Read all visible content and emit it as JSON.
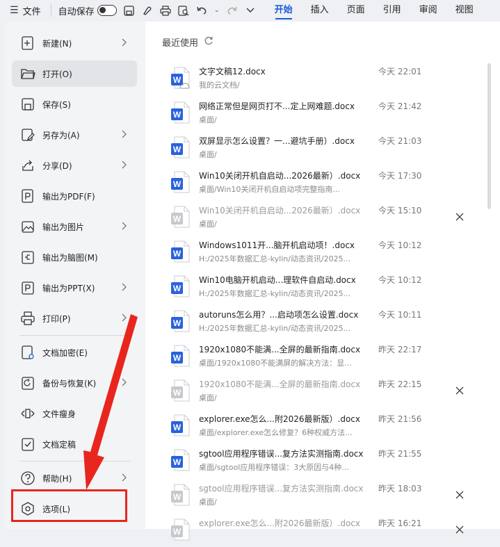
{
  "topbar": {
    "file_label": "文件",
    "autosave_label": "自动保存",
    "tabs": [
      "开始",
      "插入",
      "页面",
      "引用",
      "审阅",
      "视图"
    ]
  },
  "menu": {
    "items": [
      {
        "label": "新建(N)",
        "icon": "new-doc-icon",
        "chevron": true
      },
      {
        "label": "打开(O)",
        "icon": "folder-icon",
        "chevron": false
      },
      {
        "label": "保存(S)",
        "icon": "save-icon",
        "chevron": false
      },
      {
        "label": "另存为(A)",
        "icon": "save-as-icon",
        "chevron": true
      },
      {
        "label": "分享(D)",
        "icon": "share-icon",
        "chevron": true
      },
      {
        "label": "输出为PDF(F)",
        "icon": "pdf-icon",
        "chevron": false
      },
      {
        "label": "输出为图片",
        "icon": "image-icon",
        "chevron": true
      },
      {
        "label": "输出为脑图(M)",
        "icon": "mindmap-icon",
        "chevron": false
      },
      {
        "label": "输出为PPT(X)",
        "icon": "ppt-icon",
        "chevron": true
      },
      {
        "label": "打印(P)",
        "icon": "print-icon",
        "chevron": true
      },
      {
        "label": "文档加密(E)",
        "icon": "lock-doc-icon",
        "chevron": true
      },
      {
        "label": "备份与恢复(K)",
        "icon": "backup-icon",
        "chevron": true
      },
      {
        "label": "文件瘦身",
        "icon": "slim-icon",
        "chevron": false
      },
      {
        "label": "文档定稿",
        "icon": "finalize-icon",
        "chevron": false
      },
      {
        "label": "帮助(H)",
        "icon": "help-icon",
        "chevron": true
      },
      {
        "label": "选项(L)",
        "icon": "options-icon",
        "chevron": false
      }
    ]
  },
  "recent": {
    "title": "最近使用",
    "files": [
      {
        "name": "文字文稿12.docx",
        "path": "我的云文档/",
        "time": "今天 22:01",
        "dim": false,
        "close": false,
        "cloud": true
      },
      {
        "name": "网络正常但是网页打不...定上网难题.docx",
        "path": "桌面/",
        "time": "今天 21:42",
        "dim": false,
        "close": false
      },
      {
        "name": "双屏显示怎么设置？一...避坑手册）.docx",
        "path": "桌面/",
        "time": "今天 21:03",
        "dim": false,
        "close": false
      },
      {
        "name": "Win10关闭开机自启动...2026最新）.docx",
        "path": "桌面/Win10关闭开机自启动项完整指南...",
        "time": "今天 17:30",
        "dim": false,
        "close": false
      },
      {
        "name": "Win10关闭开机自启动...2026最新）.docx",
        "path": "桌面/",
        "time": "今天 15:10",
        "dim": true,
        "close": true
      },
      {
        "name": "Windows1011开...脑开机启动项！.docx",
        "path": "H:/2025年数据汇总-kylin/动态资讯/2025...",
        "time": "今天 10:12",
        "dim": false,
        "close": false
      },
      {
        "name": "Win10电脑开机启动...理软件自启动.docx",
        "path": "H:/2025年数据汇总-kylin/动态资讯/2025...",
        "time": "今天 10:12",
        "dim": false,
        "close": false
      },
      {
        "name": "autoruns怎么用？...启动项怎么设置.docx",
        "path": "H:/2025年数据汇总-kylin/动态资讯/2025...",
        "time": "今天 10:11",
        "dim": false,
        "close": false
      },
      {
        "name": "1920x1080不能满...全屏的最新指南.docx",
        "path": "桌面/1920x1080不能满屏的解决方法：显...",
        "time": "昨天 22:17",
        "dim": false,
        "close": false
      },
      {
        "name": "1920x1080不能满...全屏的最新指南.docx",
        "path": "桌面/",
        "time": "昨天 22:15",
        "dim": true,
        "close": true
      },
      {
        "name": "explorer.exe怎么...附2026最新版）.docx",
        "path": "桌面/explorer.exe怎么修复？6种权威方法...",
        "time": "昨天 21:56",
        "dim": false,
        "close": false
      },
      {
        "name": "sgtool应用程序错误...复方法实测指南.docx",
        "path": "桌面/sgtool应用程序错误：3大原因与4种...",
        "time": "昨天 21:55",
        "dim": false,
        "close": false
      },
      {
        "name": "sgtool应用程序错误...复方法实测指南.docx",
        "path": "桌面/",
        "time": "昨天 18:03",
        "dim": true,
        "close": true
      },
      {
        "name": "explorer.exe怎么...附2026最新版）.docx",
        "path": "",
        "time": "昨天 16:21",
        "dim": true,
        "close": true
      }
    ]
  },
  "colors": {
    "accent": "#1a5ad8",
    "word_blue": "#2a62dd",
    "highlight_red": "#e8261d"
  }
}
